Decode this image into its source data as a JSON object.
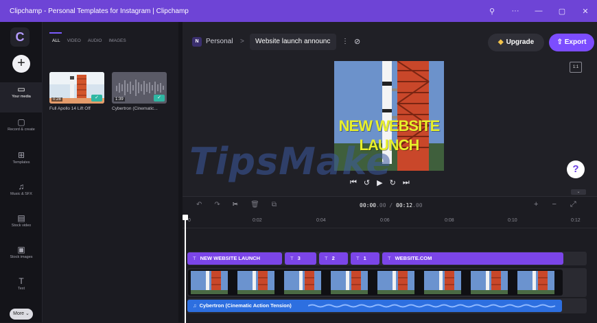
{
  "window": {
    "title": "Clipchamp - Personal Templates for Instagram | Clipchamp",
    "controls": [
      "⚲",
      "···",
      "—",
      "▢",
      "✕"
    ]
  },
  "sidebar": {
    "items": [
      {
        "label": "Your media",
        "icon": "folder-icon",
        "glyph": "▭"
      },
      {
        "label": "Record & create",
        "icon": "camera-icon",
        "glyph": "▢"
      },
      {
        "label": "Templates",
        "icon": "templates-icon",
        "glyph": "⊞"
      },
      {
        "label": "Music & SFX",
        "icon": "music-icon",
        "glyph": "♫"
      },
      {
        "label": "Stock video",
        "icon": "film-icon",
        "glyph": "▤"
      },
      {
        "label": "Stock images",
        "icon": "image-icon",
        "glyph": "▣"
      },
      {
        "label": "Text",
        "icon": "text-icon",
        "glyph": "T"
      }
    ],
    "more_label": "More ⌄",
    "add_label": "+"
  },
  "library": {
    "tabs": [
      "ALL",
      "VIDEO",
      "AUDIO",
      "IMAGES"
    ],
    "items": [
      {
        "name": "Full Apollo 14 Lift Off",
        "duration": "0:28"
      },
      {
        "name": "Cybertron (Cinematic...",
        "duration": "1:39"
      }
    ]
  },
  "topbar": {
    "workspace_initial": "N",
    "workspace_name": "Personal",
    "separator": ">",
    "project_name": "Website launch announc",
    "kebab": "⋮",
    "upgrade_label": "Upgrade",
    "export_label": "Export",
    "aspect_ratio": "1:1"
  },
  "preview": {
    "headline_line1": "NEW WEBSITE",
    "headline_line2": "LAUNCH",
    "controls": [
      "⏮",
      "↺",
      "▶",
      "↻",
      "⏭"
    ]
  },
  "help_label": "?",
  "timeline": {
    "current_time": "00:00",
    "current_frac": ".00",
    "total_time": "00:12",
    "total_frac": ".00",
    "ticks": [
      "0",
      "0:02",
      "0:04",
      "0:06",
      "0:08",
      "0:10",
      "0:12"
    ],
    "text_clips": [
      {
        "label": "NEW WEBSITE LAUNCH"
      },
      {
        "label": "3"
      },
      {
        "label": "2"
      },
      {
        "label": "1"
      },
      {
        "label": "WEBSITE.COM"
      }
    ],
    "audio_clip": "Cybertron (Cinematic Action Tension)",
    "tools": [
      "↶",
      "↷",
      "✂",
      "🗑",
      "⧉"
    ],
    "zoom": [
      "+",
      "−",
      "⤢"
    ]
  },
  "watermark": "TipsMake",
  "colors": {
    "accent": "#7c4dff",
    "titlebar": "#6e44d6",
    "text_clip": "#7b45e8",
    "audio_clip": "#2d6fe0",
    "headline": "#e7ef2a"
  }
}
